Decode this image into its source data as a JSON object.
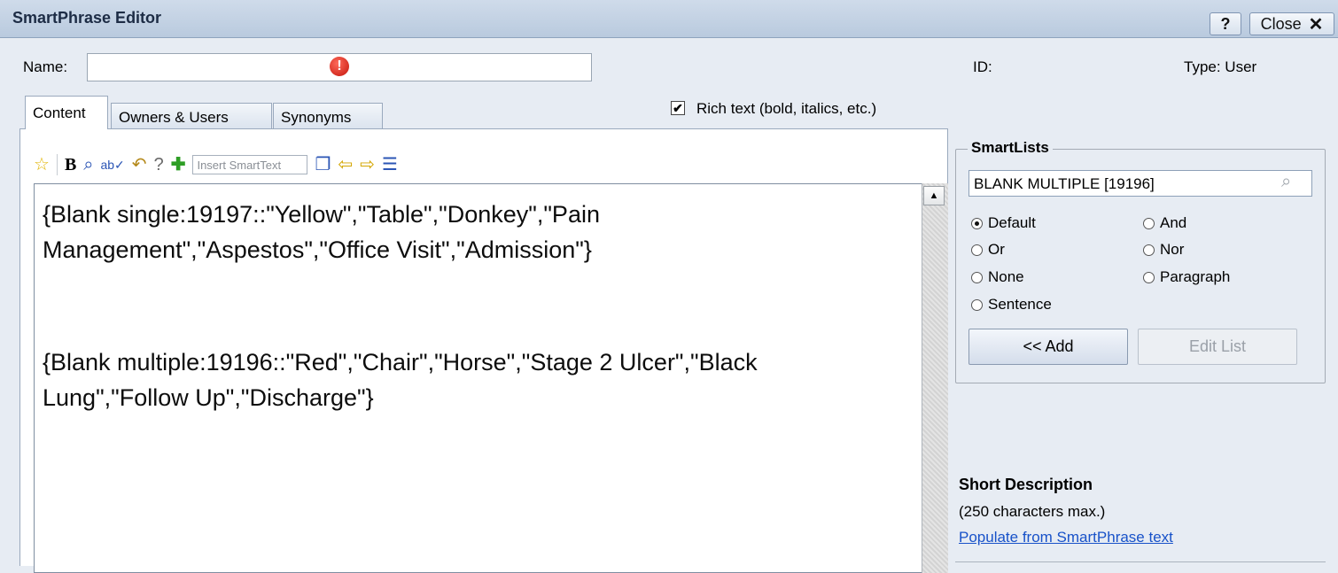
{
  "window": {
    "title": "SmartPhrase Editor",
    "help_label": "?",
    "close_label": "Close",
    "close_icon": "✕"
  },
  "header": {
    "name_label": "Name:",
    "name_value": "",
    "error_icon": "!",
    "id_label": "ID:",
    "type_label": "Type: User"
  },
  "tabs": [
    {
      "label": "Content",
      "selected": true
    },
    {
      "label": "Owners & Users",
      "selected": false
    },
    {
      "label": "Synonyms",
      "selected": false
    }
  ],
  "rich_text": {
    "checked": true,
    "label": "Rich text (bold, italics, etc.)"
  },
  "toolbar": {
    "insert_smarttext_placeholder": "Insert SmartText",
    "icons": [
      "favorite-star-icon",
      "bold-icon",
      "zoom-search-icon",
      "spellcheck-icon",
      "undo-icon",
      "help-search-icon",
      "add-icon",
      "popup-window-icon",
      "arrow-left-icon",
      "arrow-right-icon",
      "list-icon"
    ]
  },
  "editor": {
    "paragraphs": [
      "{Blank single:19197::\"Yellow\",\"Table\",\"Donkey\",\"Pain Management\",\"Aspestos\",\"Office Visit\",\"Admission\"}",
      "{Blank multiple:19196::\"Red\",\"Chair\",\"Horse\",\"Stage 2 Ulcer\",\"Black Lung\",\"Follow Up\",\"Discharge\"}"
    ]
  },
  "smartlists": {
    "title": "SmartLists",
    "search_value": "BLANK MULTIPLE [19196]",
    "options": [
      {
        "label": "Default",
        "selected": true
      },
      {
        "label": "And",
        "selected": false
      },
      {
        "label": "Or",
        "selected": false
      },
      {
        "label": "Nor",
        "selected": false
      },
      {
        "label": "None",
        "selected": false
      },
      {
        "label": "Paragraph",
        "selected": false
      },
      {
        "label": "Sentence",
        "selected": false
      }
    ],
    "add_label": "<< Add",
    "edit_label": "Edit List"
  },
  "short_description": {
    "title": "Short Description",
    "hint": "(250 characters max.)",
    "populate_link": "Populate from SmartPhrase text"
  }
}
